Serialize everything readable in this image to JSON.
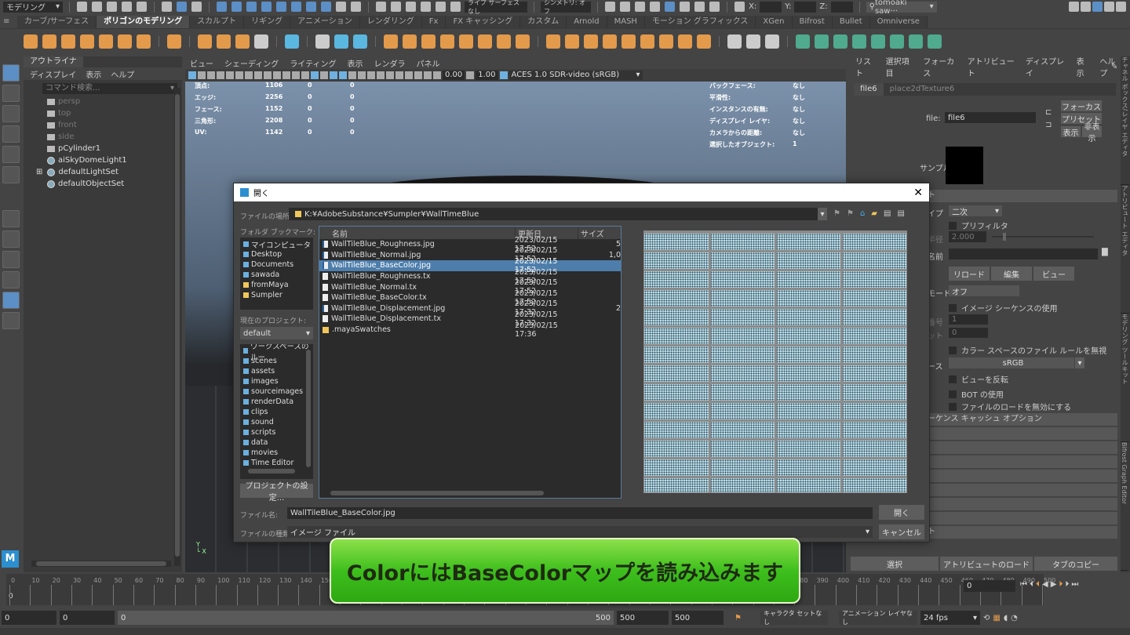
{
  "status_line": {
    "mode": "モデリング",
    "live_surface": "ライブ サーフェスなし",
    "symmetry": "シンメトリ: オフ",
    "x_label": "X:",
    "y_label": "Y:",
    "z_label": "Z:",
    "user": "tomoaki saw···"
  },
  "shelf_tabs": [
    "カーブ/サーフェス",
    "ポリゴンのモデリング",
    "スカルプト",
    "リギング",
    "アニメーション",
    "レンダリング",
    "Fx",
    "FX キャッシング",
    "カスタム",
    "Arnold",
    "MASH",
    "モーション グラフィックス",
    "XGen",
    "Bifrost",
    "Bullet",
    "Omniverse"
  ],
  "shelf_active": "ポリゴンのモデリング",
  "outliner": {
    "tab": "アウトライナ",
    "menu": [
      "ディスプレイ",
      "表示",
      "ヘルプ"
    ],
    "search_placeholder": "コマンド検索...",
    "items": [
      {
        "label": "persp",
        "dim": true,
        "icon": "camera-icon"
      },
      {
        "label": "top",
        "dim": true,
        "icon": "camera-icon"
      },
      {
        "label": "front",
        "dim": true,
        "icon": "camera-icon"
      },
      {
        "label": "side",
        "dim": true,
        "icon": "camera-icon"
      },
      {
        "label": "pCylinder1",
        "dim": false,
        "icon": "mesh-icon"
      },
      {
        "label": "aiSkyDomeLight1",
        "dim": false,
        "icon": "skydome-light-icon"
      },
      {
        "label": "defaultLightSet",
        "dim": false,
        "icon": "set-icon",
        "expand": "⊞"
      },
      {
        "label": "defaultObjectSet",
        "dim": false,
        "icon": "set-icon"
      }
    ]
  },
  "viewport": {
    "menu": [
      "ビュー",
      "シェーディング",
      "ライティング",
      "表示",
      "レンダラ",
      "パネル"
    ],
    "exposure": "0.00",
    "gamma": "1.00",
    "color_transform": "ACES 1.0 SDR-video (sRGB)",
    "hud_left": [
      {
        "label": "頂点:",
        "v": [
          "1106",
          "0",
          "0"
        ]
      },
      {
        "label": "エッジ:",
        "v": [
          "2256",
          "0",
          "0"
        ]
      },
      {
        "label": "フェース:",
        "v": [
          "1152",
          "0",
          "0"
        ]
      },
      {
        "label": "三角形:",
        "v": [
          "2208",
          "0",
          "0"
        ]
      },
      {
        "label": "UV:",
        "v": [
          "1142",
          "0",
          "0"
        ]
      }
    ],
    "hud_right": [
      {
        "label": "バックフェース:",
        "v": "なし"
      },
      {
        "label": "平滑性:",
        "v": "なし"
      },
      {
        "label": "インスタンスの有無:",
        "v": "なし"
      },
      {
        "label": "ディスプレイ レイヤ:",
        "v": "なし"
      },
      {
        "label": "カメラからの距離:",
        "v": "なし"
      },
      {
        "label": "選択したオブジェクト:",
        "v": "1"
      }
    ]
  },
  "attribute_editor": {
    "menu": [
      "リスト",
      "選択項目",
      "フォーカス",
      "アトリビュート",
      "ディスプレイ",
      "表示",
      "ヘルプ"
    ],
    "tabs": [
      "file6",
      "place2dTexture6"
    ],
    "file_label": "file:",
    "file_value": "file6",
    "focus": "フォーカス",
    "preset": "プリセット",
    "show": "表示",
    "hide": "非表示",
    "sample_label": "サンプル",
    "section": "ト",
    "filter_type_label": "イプ",
    "filter_type": "二次",
    "prefilter": "プリフィルタ",
    "radius_label": "半径",
    "radius": "2.000",
    "name_label": "名前",
    "reload": "リロード",
    "edit": "編集",
    "view": "ビュー",
    "mode_label": "モード",
    "mode": "オフ",
    "use_sequence": "イメージ シーケンスの使用",
    "frame_label": "番号",
    "frame": "1",
    "offset_label": "ット",
    "offset": "0",
    "ignore_cs": "カラー スペースのファイル ルールを無視",
    "colorspace_label": "ース",
    "colorspace": "sRGB",
    "invert_view": "ビューを反転",
    "use_bot": "BOT の使用",
    "disable_load": "ファイルのロードを無効にする",
    "cache_section": "ーケンス キャッシュ オプション",
    "last_section": "ト",
    "select": "選択",
    "load_attr": "アトリビュートのロード",
    "copy_tab": "タブのコピー"
  },
  "side_tabs": [
    "チャネル ボックス/レイヤ エディタ",
    "アトリビュート エディタ",
    "モデリング ツールキット",
    "Bifrost Graph Editor"
  ],
  "dialog": {
    "title": "開く",
    "location_label": "ファイルの場所:",
    "location": "K:¥AdobeSubstance¥Sumpler¥WallTimeBlue",
    "bookmarks_label": "フォルダ ブックマーク:",
    "bookmarks": [
      {
        "label": "マイコンピュータ"
      },
      {
        "label": "Desktop"
      },
      {
        "label": "Documents"
      },
      {
        "label": "sawada"
      },
      {
        "label": "fromMaya"
      },
      {
        "label": "Sumpler"
      }
    ],
    "project_label": "現在のプロジェクト:",
    "project": "default",
    "workspace": [
      "ワークスペースのルー",
      "scenes",
      "assets",
      "images",
      "sourceimages",
      "renderData",
      "clips",
      "sound",
      "scripts",
      "data",
      "movies",
      "Time Editor"
    ],
    "project_settings": "プロジェクトの設定...",
    "columns": [
      "名前",
      "更新日",
      "サイズ"
    ],
    "files": [
      {
        "name": "WallTileBlue_Roughness.jpg",
        "date": "2023/02/15 17:52",
        "size": "5",
        "type": "jpg"
      },
      {
        "name": "WallTileBlue_Normal.jpg",
        "date": "2023/02/15 17:52",
        "size": "1,0",
        "type": "jpg"
      },
      {
        "name": "WallTileBlue_BaseColor.jpg",
        "date": "2023/02/15 17:52",
        "size": "",
        "type": "jpg",
        "selected": true
      },
      {
        "name": "WallTileBlue_Roughness.tx",
        "date": "2023/02/15 17:52",
        "size": "",
        "type": "tx"
      },
      {
        "name": "WallTileBlue_Normal.tx",
        "date": "2023/02/15 17:52",
        "size": "",
        "type": "tx"
      },
      {
        "name": "WallTileBlue_BaseColor.tx",
        "date": "2023/02/15 17:52",
        "size": "",
        "type": "tx"
      },
      {
        "name": "WallTileBlue_Displacement.jpg",
        "date": "2023/02/15 17:32",
        "size": "2",
        "type": "jpg"
      },
      {
        "name": "WallTileBlue_Displacement.tx",
        "date": "2023/02/15 17:32",
        "size": "",
        "type": "tx"
      },
      {
        "name": ".mayaSwatches",
        "date": "2023/02/15 17:36",
        "size": "",
        "type": "folder"
      }
    ],
    "filename_label": "ファイル名:",
    "filename": "WallTileBlue_BaseColor.jpg",
    "filetype_label": "ファイルの種類:",
    "filetype": "イメージ ファイル",
    "open": "開く",
    "cancel": "キャンセル"
  },
  "timeline": {
    "start": 0,
    "end": 500,
    "step": 10,
    "current_frame_marker": "0",
    "current_frame": "0"
  },
  "range": {
    "start": "0",
    "anim_start": "0",
    "slider_start": "0",
    "slider_end": "500",
    "anim_end": "500",
    "end": "500",
    "character_set": "キャラクタ セットなし",
    "anim_layer": "アニメーション レイヤなし",
    "fps": "24 fps"
  },
  "banner": "ColorにはBaseColorマップを読み込みます",
  "colors": {
    "accent": "#5b8fc5",
    "selection": "#4d7eab",
    "banner": "#3ebf1d",
    "shelf_orange": "#e39a4b"
  }
}
